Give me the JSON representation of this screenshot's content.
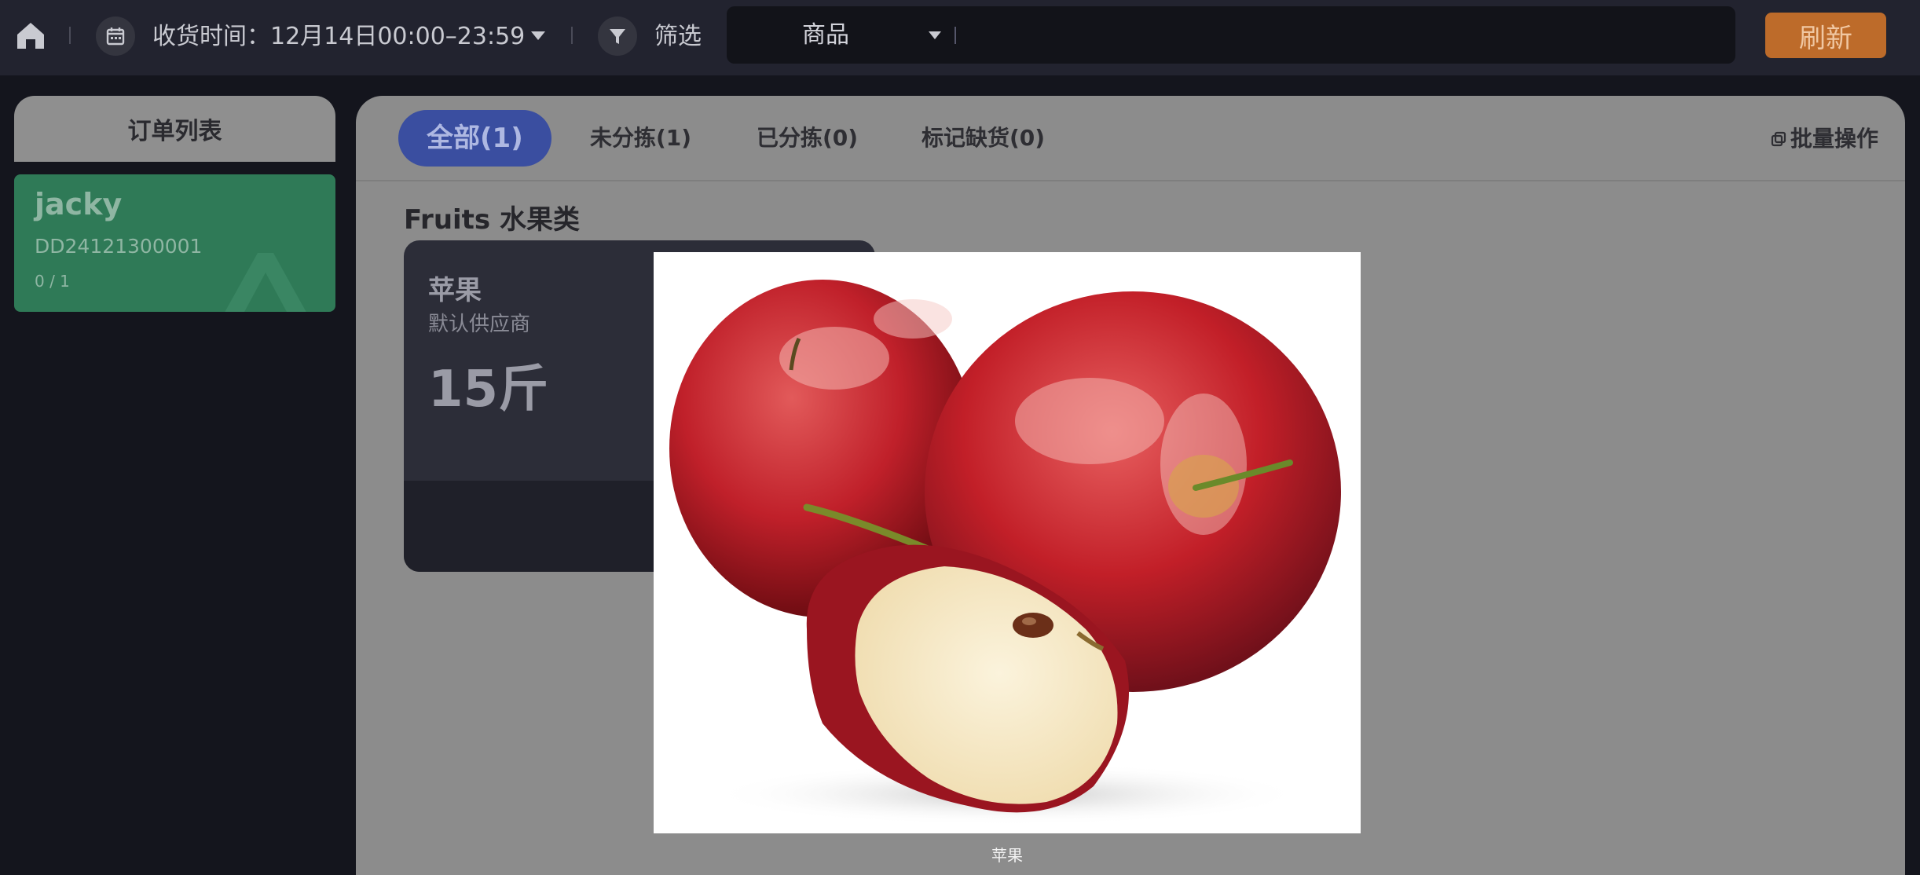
{
  "topbar": {
    "receive_time_label": "收货时间：12月14日00:00–23:59",
    "filter_label": "筛选",
    "search_select_value": "商品",
    "search_placeholder": "",
    "refresh_label": "刷新"
  },
  "sidebar": {
    "title": "订单列表",
    "orders": [
      {
        "name": "jacky",
        "order_no": "DD24121300001",
        "progress": "0 / 1"
      }
    ]
  },
  "main": {
    "tabs": [
      {
        "label": "全部(1)",
        "active": true
      },
      {
        "label": "未分拣(1)",
        "active": false
      },
      {
        "label": "已分拣(0)",
        "active": false
      },
      {
        "label": "标记缺货(0)",
        "active": false
      }
    ],
    "batch_label": "批量操作",
    "category_title": "Fruits 水果类",
    "products": [
      {
        "name": "苹果",
        "supplier": "默认供应商",
        "quantity": "15斤"
      }
    ]
  },
  "preview": {
    "caption": "苹果",
    "image_subject": "apple-photo"
  },
  "colors": {
    "accent_tab": "#3a4ea0",
    "order_card": "#2f7a57",
    "refresh_button": "#bd6b2a"
  }
}
